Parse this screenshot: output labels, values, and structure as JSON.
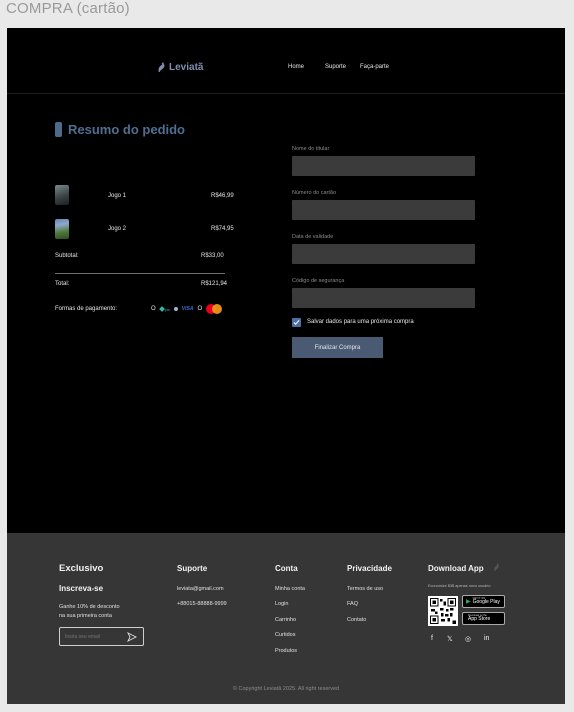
{
  "frame_label": "COMPRA (cartão)",
  "header": {
    "logo": "Leviatã",
    "nav": [
      "Home",
      "Suporte",
      "Faça-parte"
    ]
  },
  "summary": {
    "title": "Resumo do pedido",
    "items": [
      {
        "name": "Jogo 1",
        "price": "R$46,99"
      },
      {
        "name": "Jogo 2",
        "price": "R$74,95"
      }
    ],
    "subtotal_label": "Subtotal:",
    "subtotal_value": "R$33,00",
    "total_label": "Total:",
    "total_value": "R$121,94",
    "payment_label": "Formas de pagamento:",
    "payment_icons": [
      "pix",
      "visa",
      "mastercard"
    ],
    "pix_text": "pix",
    "visa_text": "VISA",
    "radio_glyph": "O"
  },
  "form": {
    "holder_label": "Nome do titular",
    "card_label": "Número do cartão",
    "expiry_label": "Data de validade",
    "cvv_label": "Código de segurança",
    "save_label": "Salvar  dados para uma próxima compra",
    "save_checked": true,
    "submit_label": "Finalizar Compra"
  },
  "footer": {
    "exclusive": {
      "title": "Exclusivo",
      "subtitle": "Inscreva-se",
      "line1": "Ganhe 10% de desconto",
      "line2": "na sua primeira conta",
      "email_placeholder": "Insira seu email"
    },
    "support": {
      "title": "Suporte",
      "email": "leviata@gmail.com",
      "phone": "+88015-88888-9999"
    },
    "account": {
      "title": "Conta",
      "links": [
        "Minha conta",
        "Login",
        "Carrinho",
        "Curtidos",
        "Produtos"
      ]
    },
    "privacy": {
      "title": "Privacidade",
      "links": [
        "Termos de uso",
        "FAQ",
        "Contato"
      ]
    },
    "app": {
      "title": "Download App",
      "note": "Economize $3$ apenas novo usuário",
      "google_small": "GET IT ON",
      "google_name": "Google Play",
      "apple_small": "Download on the",
      "apple_name": "App Store"
    },
    "social_icons": [
      "facebook-icon",
      "x-icon",
      "instagram-icon",
      "linkedin-icon"
    ],
    "social_glyphs": {
      "facebook": "f",
      "x": "𝕏",
      "instagram": "◎",
      "linkedin": "in"
    },
    "copyright": "Copyright Leviatã 2025. All right reserved"
  },
  "colors": {
    "background": "#000000",
    "accent": "#4f6e92",
    "input": "#3b3b3b",
    "button": "#4a5a73",
    "footer": "#363636"
  }
}
